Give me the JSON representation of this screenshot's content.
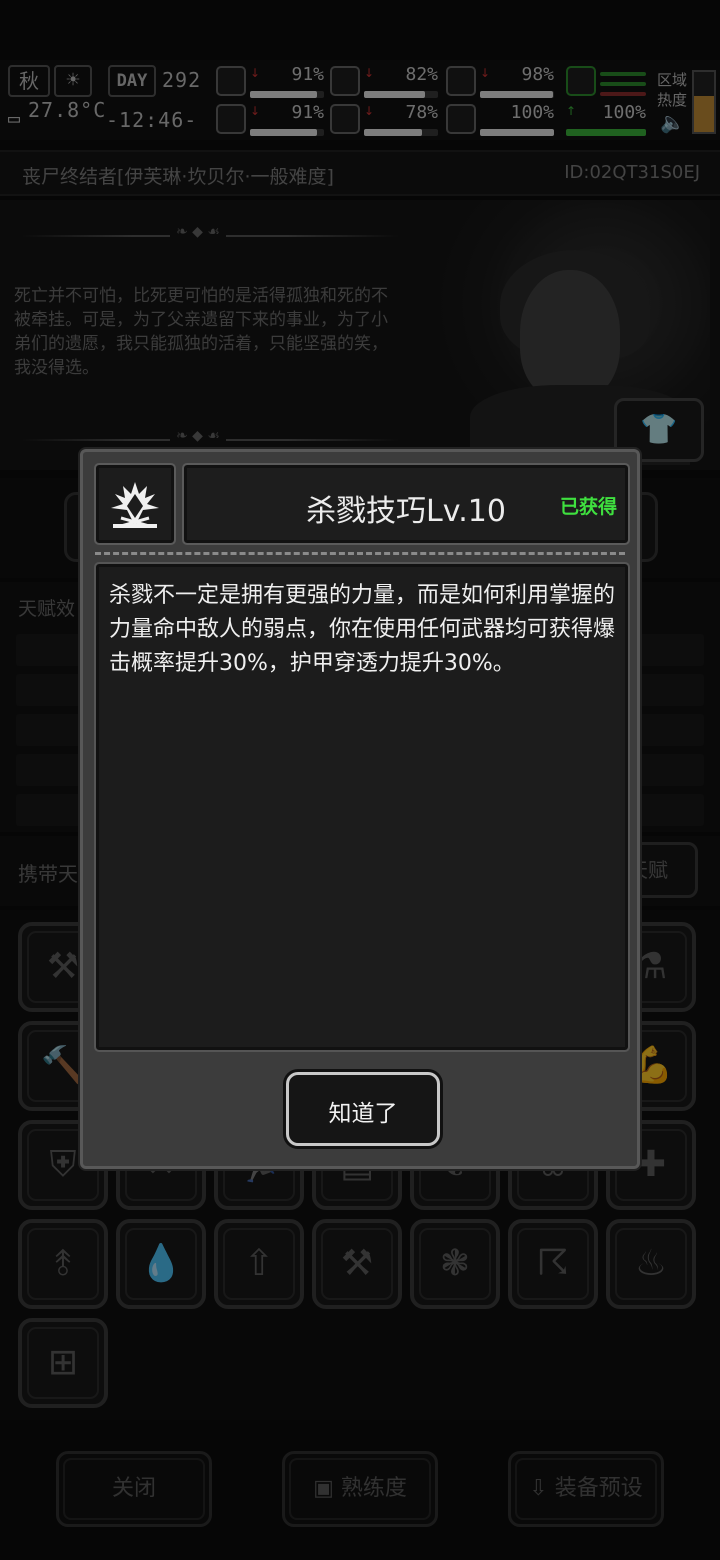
{
  "status_bar": {
    "season": "秋",
    "day_label": "DAY",
    "day_number": "292",
    "temperature": "27.8°C",
    "time": "-12:46-",
    "stats": [
      {
        "icon": "medkit-icon",
        "trend": "down",
        "value": "91%",
        "level": 0.91
      },
      {
        "icon": "stomach-icon",
        "trend": "down",
        "value": "82%",
        "level": 0.82
      },
      {
        "icon": "pill-icon",
        "trend": "down",
        "value": "98%",
        "level": 0.98
      },
      {
        "icon": "stamina-icon",
        "trend": "flat",
        "value": "",
        "level": 1.0
      },
      {
        "icon": "brain-icon",
        "trend": "down",
        "value": "91%",
        "level": 0.91
      },
      {
        "icon": "water-drop-icon",
        "trend": "down",
        "value": "78%",
        "level": 0.78
      },
      {
        "icon": "heart-icon",
        "trend": "flat",
        "value": "100%",
        "level": 1.0
      },
      {
        "icon": "energy-icon",
        "trend": "up",
        "value": "100%",
        "level": 1.0
      }
    ],
    "heat_label": "区域热度",
    "heat_level": 0.6
  },
  "page": {
    "title": "丧尸终结者[伊芙琳·坎贝尔·一般难度]",
    "player_id": "ID:02QT31S0EJ",
    "bio_quote": "死亡并不可怕，比死更可怕的是活得孤独和死的不被牵挂。可是，为了父亲遗留下来的事业，为了小弟们的遗愿，我只能孤独的活着，只能坚强的笑，我没得选。",
    "talent_effect_label": "天赋效",
    "carry_label": "携带天",
    "carry_button": "天赋"
  },
  "skill_grid": [
    "crossed-axes-icon",
    "",
    "",
    "",
    "",
    "",
    "potion-icon",
    "hammer-icon",
    "",
    "",
    "",
    "",
    "",
    "muscle-icon",
    "shield-up-icon",
    "x-icon",
    "run-icon",
    "box-icon",
    "leaf-icon",
    "paw-icon",
    "medkit-up-icon",
    "stomach-up-icon",
    "drop-up-icon",
    "boot-up-icon",
    "crossed-axes-icon",
    "brain-icon",
    "storm-up-icon",
    "rest-icon",
    "dumbbell-icon"
  ],
  "bottom_bar": {
    "close": "关闭",
    "proficiency": "熟练度",
    "equipment_preset": "装备预设"
  },
  "dialog": {
    "skill_icon": "crown-blade-icon",
    "skill_title": "杀戮技巧Lv.10",
    "status": "已获得",
    "status_color": "#3fe03f",
    "description": "杀戮不一定是拥有更强的力量，而是如何利用掌握的力量命中敌人的弱点，你在使用任何武器均可获得爆击概率提升30%，护甲穿透力提升30%。",
    "ok_button": "知道了"
  }
}
